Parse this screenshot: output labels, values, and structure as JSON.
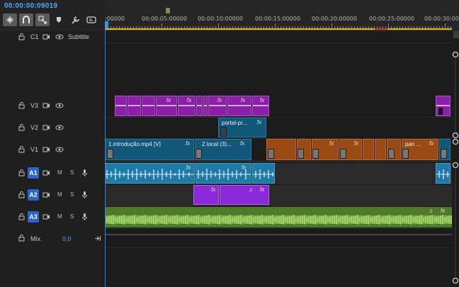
{
  "timecode": "00:00:00:09019",
  "ruler": {
    "labels": [
      ":00000",
      "00:00:05:00000",
      "00:00:10:00000",
      "00:00:15:00000",
      "00:00:20:00000",
      "00:00:25:00000",
      "00:00:30:00"
    ]
  },
  "tools": [
    {
      "name": "snap-tool",
      "icon": "snap-icon",
      "on": true
    },
    {
      "name": "magnet-tool",
      "icon": "magnet-icon",
      "on": true
    },
    {
      "name": "linked-selection-tool",
      "icon": "linked-selection-icon",
      "on": true
    },
    {
      "name": "add-marker-tool",
      "icon": "marker-icon",
      "on": false
    },
    {
      "name": "wrench-tool",
      "icon": "wrench-icon",
      "on": false
    },
    {
      "name": "captions-tool",
      "icon": "captions-icon",
      "on": false
    }
  ],
  "tracks": {
    "subtitle": {
      "name": "C1",
      "label": "Subtitle"
    },
    "v3": {
      "name": "V3"
    },
    "v2": {
      "name": "V2"
    },
    "v1": {
      "name": "V1"
    },
    "a1": {
      "name": "A1",
      "m": "M",
      "s": "S"
    },
    "a2": {
      "name": "A2",
      "m": "M",
      "s": "S"
    },
    "a3": {
      "name": "A3",
      "m": "M",
      "s": "S"
    },
    "mix": {
      "name": "Mix",
      "value": "0,0"
    }
  },
  "clips": {
    "v1_intro": "1.introdução.mp4 [V]",
    "v1_local": "2.local (3)...",
    "v1_pan": "pan ...",
    "v2_portal": "portal-pr...",
    "fx": "fx"
  },
  "colors": {
    "accent": "#4ea6ff",
    "video_purple": "#8a1fa8",
    "video_blue": "#10577a",
    "video_orange": "#9a4a12",
    "audio_blue": "#1f7aa6",
    "audio_purple": "#8b2ad8",
    "audio_green": "#4f7a2a"
  }
}
